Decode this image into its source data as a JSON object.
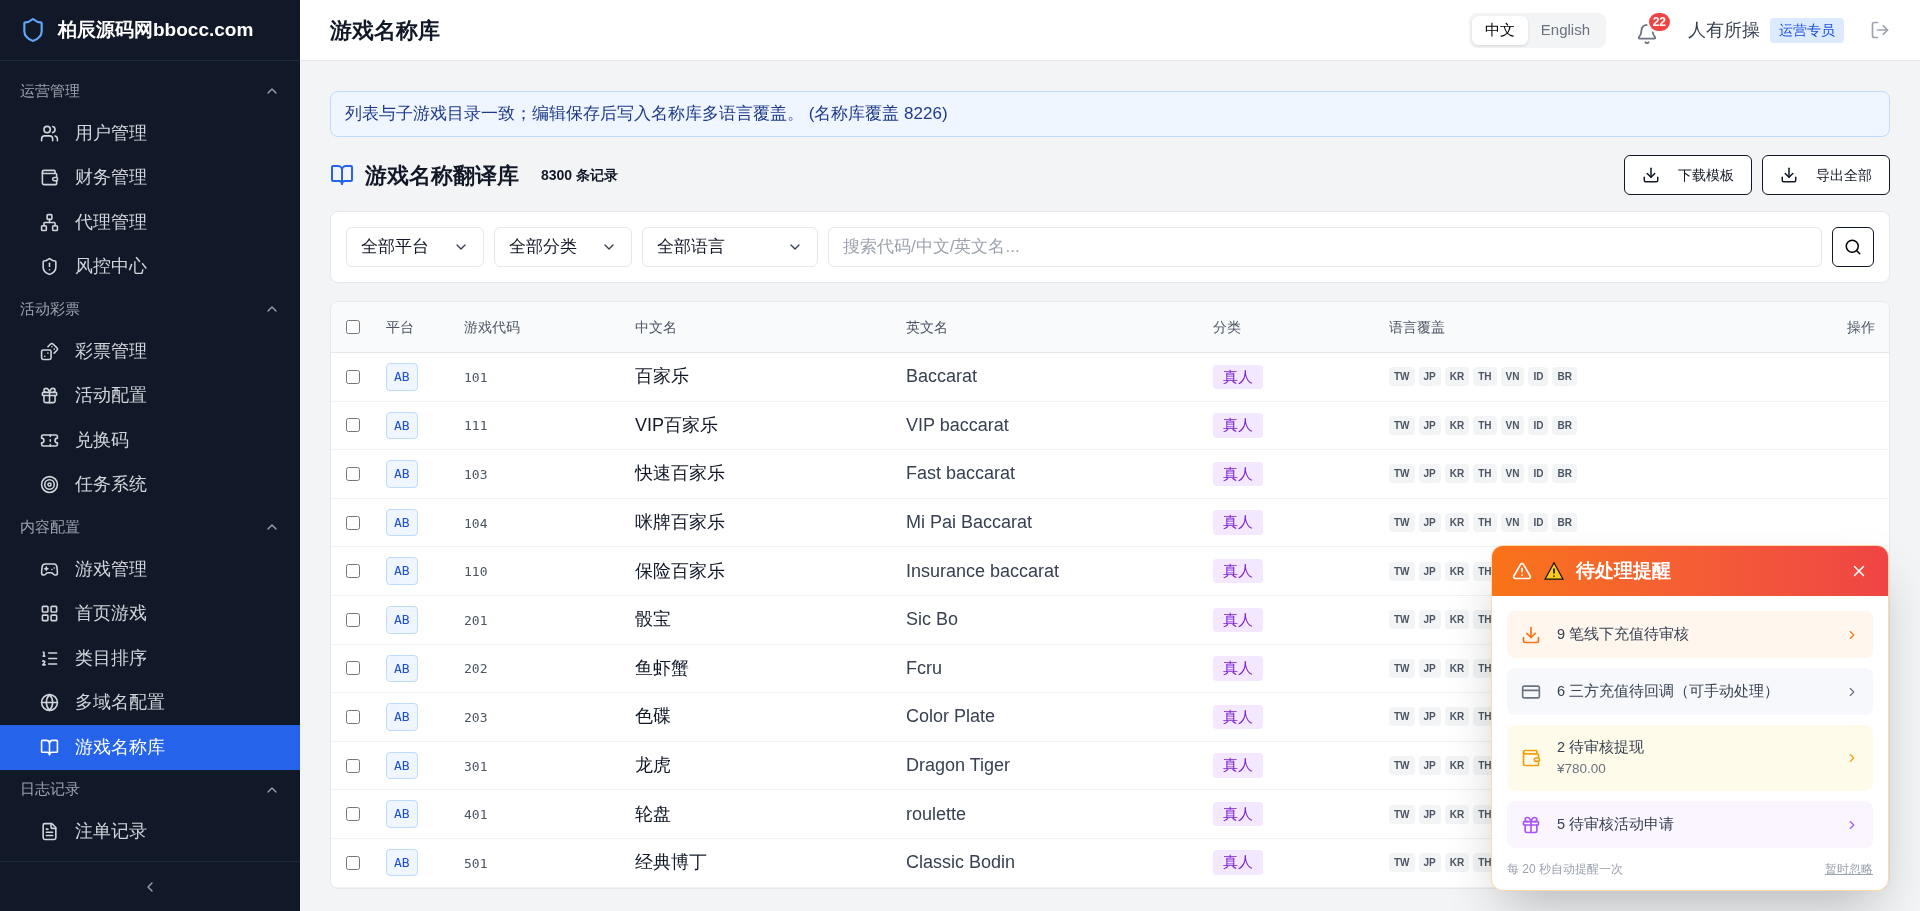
{
  "brand": {
    "name": "柏辰源码网bbocc.com"
  },
  "sidebar": {
    "groups": [
      {
        "title": "运营管理",
        "expanded": true,
        "items": [
          {
            "label": "用户管理",
            "kind": "users",
            "selected": false
          },
          {
            "label": "财务管理",
            "kind": "wallet",
            "selected": false
          },
          {
            "label": "代理管理",
            "kind": "network",
            "selected": false
          },
          {
            "label": "风控中心",
            "kind": "shield",
            "selected": false
          }
        ]
      },
      {
        "title": "活动彩票",
        "expanded": true,
        "items": [
          {
            "label": "彩票管理",
            "kind": "dice",
            "selected": false
          },
          {
            "label": "活动配置",
            "kind": "gift",
            "selected": false
          },
          {
            "label": "兑换码",
            "kind": "ticket",
            "selected": false
          },
          {
            "label": "任务系统",
            "kind": "target",
            "selected": false
          }
        ]
      },
      {
        "title": "内容配置",
        "expanded": true,
        "items": [
          {
            "label": "游戏管理",
            "kind": "gamepad",
            "selected": false
          },
          {
            "label": "首页游戏",
            "kind": "grid",
            "selected": false
          },
          {
            "label": "类目排序",
            "kind": "list",
            "selected": false
          },
          {
            "label": "多域名配置",
            "kind": "globe",
            "selected": false
          },
          {
            "label": "游戏名称库",
            "kind": "book",
            "selected": true
          }
        ]
      },
      {
        "title": "日志记录",
        "expanded": true,
        "items": [
          {
            "label": "注单记录",
            "kind": "file",
            "selected": false
          }
        ]
      }
    ]
  },
  "header": {
    "title": "游戏名称库",
    "languages": [
      {
        "label": "中文",
        "selected": true
      },
      {
        "label": "English",
        "selected": false
      }
    ],
    "notification_count": "22",
    "user": "人有所操",
    "role": "运营专员"
  },
  "notice": "列表与子游戏目录一致；编辑保存后写入名称库多语言覆盖。 (名称库覆盖 8226)",
  "section": {
    "title": "游戏名称翻译库",
    "count": "8300 条记录",
    "buttons": [
      "下载模板",
      "导出全部"
    ]
  },
  "filters": {
    "selects": [
      "全部平台",
      "全部分类",
      "全部语言"
    ],
    "search": {
      "placeholder": "搜索代码/中文/英文名..."
    }
  },
  "table": {
    "select_all_checked": false,
    "columns": [
      "平台",
      "游戏代码",
      "中文名",
      "英文名",
      "分类",
      "语言覆盖",
      "操作"
    ],
    "rows": [
      {
        "checked": false,
        "platform": "AB",
        "code": "101",
        "zh": "百家乐",
        "en": "Baccarat",
        "category": "真人",
        "langs": [
          "TW",
          "JP",
          "KR",
          "TH",
          "VN",
          "ID",
          "BR"
        ]
      },
      {
        "checked": false,
        "platform": "AB",
        "code": "111",
        "zh": "VIP百家乐",
        "en": "VIP baccarat",
        "category": "真人",
        "langs": [
          "TW",
          "JP",
          "KR",
          "TH",
          "VN",
          "ID",
          "BR"
        ]
      },
      {
        "checked": false,
        "platform": "AB",
        "code": "103",
        "zh": "快速百家乐",
        "en": "Fast baccarat",
        "category": "真人",
        "langs": [
          "TW",
          "JP",
          "KR",
          "TH",
          "VN",
          "ID",
          "BR"
        ]
      },
      {
        "checked": false,
        "platform": "AB",
        "code": "104",
        "zh": "咪牌百家乐",
        "en": "Mi Pai Baccarat",
        "category": "真人",
        "langs": [
          "TW",
          "JP",
          "KR",
          "TH",
          "VN",
          "ID",
          "BR"
        ]
      },
      {
        "checked": false,
        "platform": "AB",
        "code": "110",
        "zh": "保险百家乐",
        "en": "Insurance baccarat",
        "category": "真人",
        "langs": [
          "TW",
          "JP",
          "KR",
          "TH"
        ]
      },
      {
        "checked": false,
        "platform": "AB",
        "code": "201",
        "zh": "骰宝",
        "en": "Sic Bo",
        "category": "真人",
        "langs": [
          "TW",
          "JP",
          "KR",
          "TH"
        ]
      },
      {
        "checked": false,
        "platform": "AB",
        "code": "202",
        "zh": "鱼虾蟹",
        "en": "Fcru",
        "category": "真人",
        "langs": [
          "TW",
          "JP",
          "KR",
          "TH"
        ]
      },
      {
        "checked": false,
        "platform": "AB",
        "code": "203",
        "zh": "色碟",
        "en": "Color Plate",
        "category": "真人",
        "langs": [
          "TW",
          "JP",
          "KR",
          "TH"
        ]
      },
      {
        "checked": false,
        "platform": "AB",
        "code": "301",
        "zh": "龙虎",
        "en": "Dragon Tiger",
        "category": "真人",
        "langs": [
          "TW",
          "JP",
          "KR",
          "TH"
        ]
      },
      {
        "checked": false,
        "platform": "AB",
        "code": "401",
        "zh": "轮盘",
        "en": "roulette",
        "category": "真人",
        "langs": [
          "TW",
          "JP",
          "KR",
          "TH"
        ]
      },
      {
        "checked": false,
        "platform": "AB",
        "code": "501",
        "zh": "经典博丁",
        "en": "Classic Bodin",
        "category": "真人",
        "langs": [
          "TW",
          "JP",
          "KR",
          "TH"
        ]
      }
    ]
  },
  "alert": {
    "title": "待处理提醒",
    "items": [
      {
        "kind": "deposit",
        "text": "9 笔线下充值待审核"
      },
      {
        "kind": "card",
        "text": "6 三方充值待回调（可手动处理）"
      },
      {
        "kind": "withdraw",
        "text": "2 待审核提现",
        "sub": "¥780.00"
      },
      {
        "kind": "gift",
        "text": "5 待审核活动申请"
      }
    ],
    "footer": "每 20 秒自动提醒一次",
    "dismiss": "暂时忽略"
  }
}
